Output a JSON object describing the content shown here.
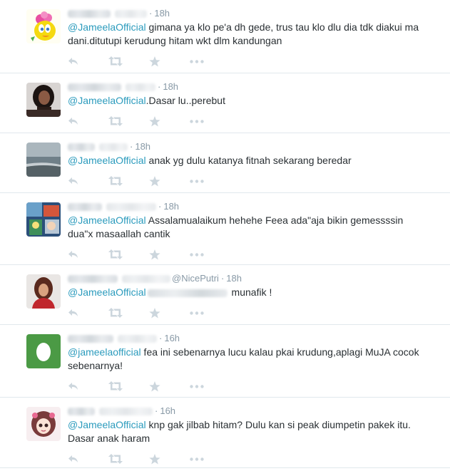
{
  "tweets": [
    {
      "handle": "",
      "time": "18h",
      "mention": "@JameelaOfficial",
      "body": " gimana ya klo pe'a dh gede, trus tau klo dlu dia tdk diakui ma dani.ditutupi kerudung hitam wkt dlm kandungan",
      "avatar": "cartoon-bird-flower"
    },
    {
      "handle": "",
      "time": "18h",
      "mention": "@JameelaOfficial",
      "body": ".Dasar lu..perebut",
      "avatar": "woman-dark-portrait"
    },
    {
      "handle": "",
      "time": "18h",
      "mention": "@JameelaOfficial",
      "body": " anak yg dulu katanya fitnah sekarang beredar",
      "avatar": "seascape"
    },
    {
      "handle": "",
      "time": "18h",
      "mention": "@JameelaOfficial",
      "body": " Assalamualaikum hehehe Feea ada\"aja bikin gemessssin dua\"x masaallah cantik",
      "avatar": "colorful-collage"
    },
    {
      "handle": "@NicePutri",
      "time": "18h",
      "mention": "@JameelaOfficial",
      "body": " munafik !",
      "body_hidden_prefix": true,
      "avatar": "woman-red-portrait"
    },
    {
      "handle": "",
      "time": "16h",
      "mention": "@jameelaofficial",
      "body": " fea ini sebenarnya lucu kalau pkai krudung,aplagi MuJA cocok sebenarnya!",
      "avatar": "default-egg"
    },
    {
      "handle": "",
      "time": "16h",
      "mention": "@JameelaOfficial",
      "body": " knp gak jilbab hitam? Dulu kan si peak diumpetin pakek itu. Dasar anak haram",
      "avatar": "anime-girl"
    }
  ],
  "icons": {
    "reply": "reply-icon",
    "retweet": "retweet-icon",
    "favorite": "star-icon",
    "more": "more-icon"
  },
  "colors": {
    "mention": "#2b9bbd",
    "meta": "#8899a6",
    "icon": "#ccd6dd",
    "border": "#e1e8ed",
    "text": "#292f33"
  }
}
